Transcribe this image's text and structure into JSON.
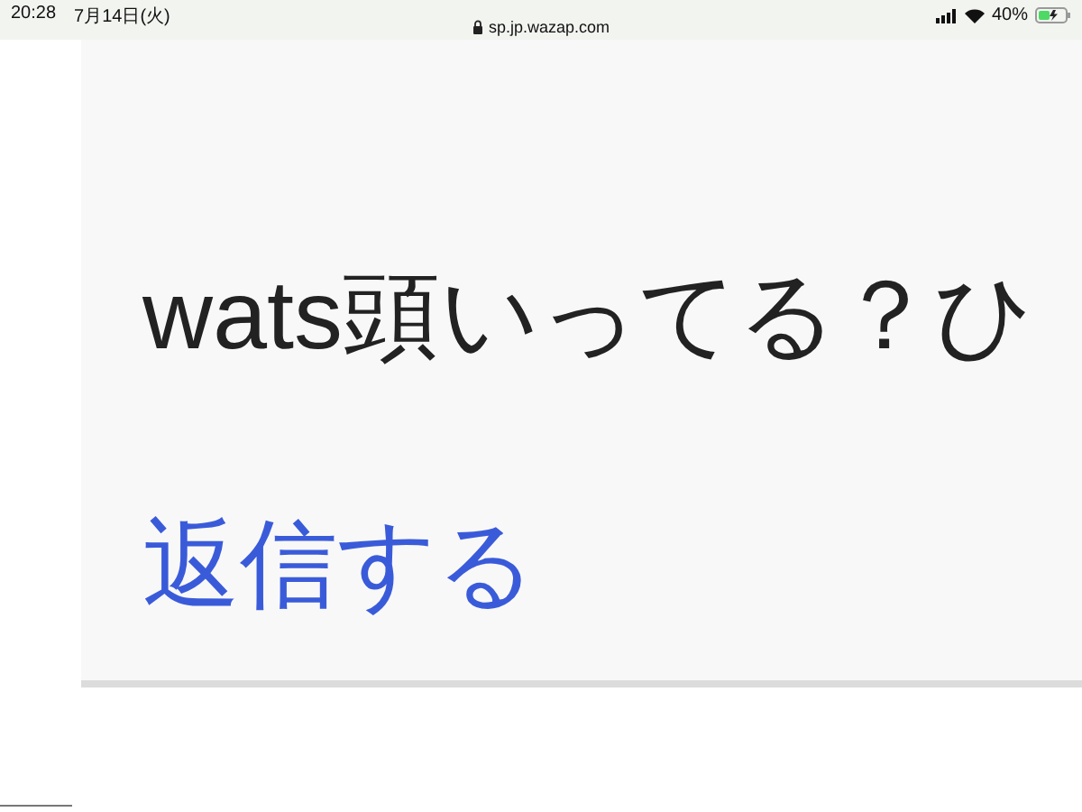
{
  "status_bar": {
    "time": "20:28",
    "date": "7月14日(火)",
    "url": "sp.jp.wazap.com",
    "battery": "40%"
  },
  "comment": {
    "text": "wats頭いってる？ひ",
    "reply_link": "返信する"
  }
}
